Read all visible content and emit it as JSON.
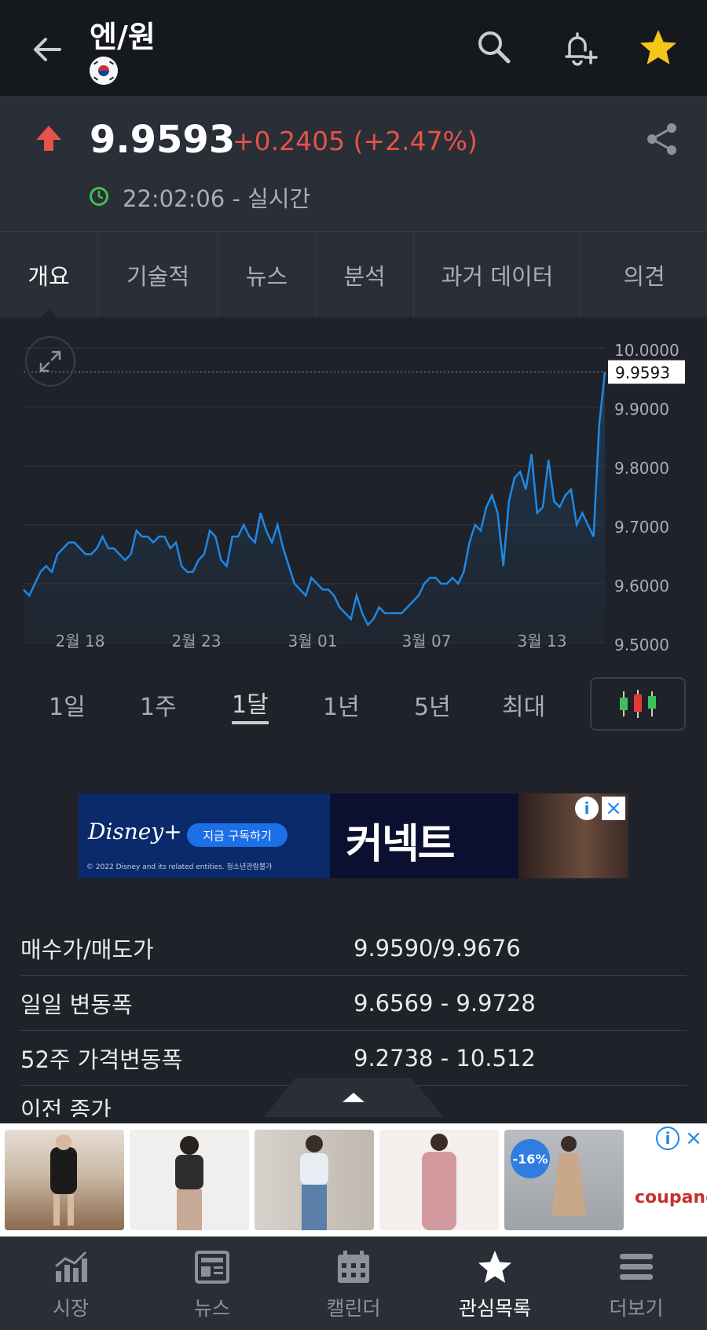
{
  "header": {
    "title": "엔/원",
    "flag": "south-korea-flag"
  },
  "quote": {
    "price": "9.9593",
    "change": "+0.2405 (+2.47%)",
    "time": "22:02:06 - 실시간",
    "direction_color": "#e5534b"
  },
  "tabs": [
    {
      "label": "개요",
      "active": true
    },
    {
      "label": "기술적"
    },
    {
      "label": "뉴스"
    },
    {
      "label": "분석"
    },
    {
      "label": "과거 데이터"
    },
    {
      "label": "의견"
    }
  ],
  "chart_data": {
    "type": "area",
    "y_ticks": [
      "10.0000",
      "9.9000",
      "9.8000",
      "9.7000",
      "9.6000",
      "9.5000"
    ],
    "x_ticks": [
      "2월 18",
      "2월 23",
      "3월 01",
      "3월 07",
      "3월 13"
    ],
    "ylim": [
      9.5,
      10.0
    ],
    "last_value_label": "9.9593",
    "values": [
      9.59,
      9.58,
      9.6,
      9.62,
      9.63,
      9.62,
      9.65,
      9.66,
      9.67,
      9.67,
      9.66,
      9.65,
      9.65,
      9.66,
      9.68,
      9.66,
      9.66,
      9.65,
      9.64,
      9.65,
      9.69,
      9.68,
      9.68,
      9.67,
      9.68,
      9.68,
      9.66,
      9.67,
      9.63,
      9.62,
      9.62,
      9.64,
      9.65,
      9.69,
      9.68,
      9.64,
      9.63,
      9.68,
      9.68,
      9.7,
      9.68,
      9.67,
      9.72,
      9.69,
      9.67,
      9.7,
      9.66,
      9.63,
      9.6,
      9.59,
      9.58,
      9.61,
      9.6,
      9.59,
      9.59,
      9.58,
      9.56,
      9.55,
      9.54,
      9.58,
      9.55,
      9.53,
      9.54,
      9.56,
      9.55,
      9.55,
      9.55,
      9.55,
      9.56,
      9.57,
      9.58,
      9.6,
      9.61,
      9.61,
      9.6,
      9.6,
      9.61,
      9.6,
      9.62,
      9.67,
      9.7,
      9.69,
      9.73,
      9.75,
      9.72,
      9.63,
      9.74,
      9.78,
      9.79,
      9.76,
      9.82,
      9.72,
      9.73,
      9.81,
      9.74,
      9.73,
      9.75,
      9.76,
      9.7,
      9.72,
      9.7,
      9.68,
      9.87,
      9.9593
    ],
    "line_color": "#1e88e5"
  },
  "range": {
    "options": [
      "1일",
      "1주",
      "1달",
      "1년",
      "5년",
      "최대"
    ],
    "selected": "1달"
  },
  "ad1": {
    "brand": "Disney+",
    "cta": "지금 구독하기",
    "title": "커넥트",
    "copyright": "© 2022 Disney and its related entities. 청소년관람불가"
  },
  "stats": [
    {
      "label": "매수가/매도가",
      "value": "9.9590/9.9676"
    },
    {
      "label": "일일 변동폭",
      "value": "9.6569 - 9.9728"
    },
    {
      "label": "52주 가격변동폭",
      "value": "9.2738 - 10.512"
    },
    {
      "label": "이전 종가",
      "value": ""
    }
  ],
  "ad2": {
    "badge": "-16%",
    "brand": "coupang"
  },
  "bottom_nav": [
    {
      "label": "시장",
      "icon": "chart-icon"
    },
    {
      "label": "뉴스",
      "icon": "news-icon"
    },
    {
      "label": "캘린더",
      "icon": "calendar-icon"
    },
    {
      "label": "관심목록",
      "icon": "star-icon",
      "active": true
    },
    {
      "label": "더보기",
      "icon": "menu-icon"
    }
  ]
}
